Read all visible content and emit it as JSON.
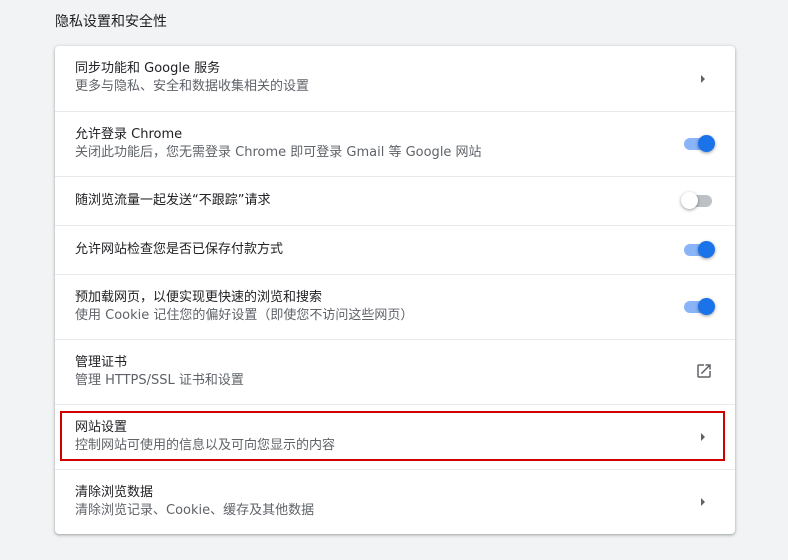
{
  "section": {
    "title": "隐私设置和安全性"
  },
  "rows": [
    {
      "label": "同步功能和 Google 服务",
      "sub": "更多与隐私、安全和数据收集相关的设置",
      "control": "arrow"
    },
    {
      "label": "允许登录 Chrome",
      "sub": "关闭此功能后，您无需登录 Chrome 即可登录 Gmail 等 Google 网站",
      "control": "toggle",
      "state": "on"
    },
    {
      "label": "随浏览流量一起发送“不跟踪”请求",
      "sub": "",
      "control": "toggle",
      "state": "off"
    },
    {
      "label": "允许网站检查您是否已保存付款方式",
      "sub": "",
      "control": "toggle",
      "state": "on"
    },
    {
      "label": "预加载网页，以便实现更快速的浏览和搜索",
      "sub": "使用 Cookie 记住您的偏好设置（即使您不访问这些网页）",
      "control": "toggle",
      "state": "on"
    },
    {
      "label": "管理证书",
      "sub": "管理 HTTPS/SSL 证书和设置",
      "control": "external-link"
    },
    {
      "label": "网站设置",
      "sub": "控制网站可使用的信息以及可向您显示的内容",
      "control": "arrow"
    },
    {
      "label": "清除浏览数据",
      "sub": "清除浏览记录、Cookie、缓存及其他数据",
      "control": "arrow"
    }
  ],
  "icons": {
    "arrow": "chevron-right-icon",
    "external": "open-in-new-icon"
  },
  "colors": {
    "toggle_on_knob": "#1a73e8",
    "toggle_on_track": "#8ab4f8",
    "toggle_off_track": "#bdc1c6",
    "highlight": "#d00000"
  }
}
